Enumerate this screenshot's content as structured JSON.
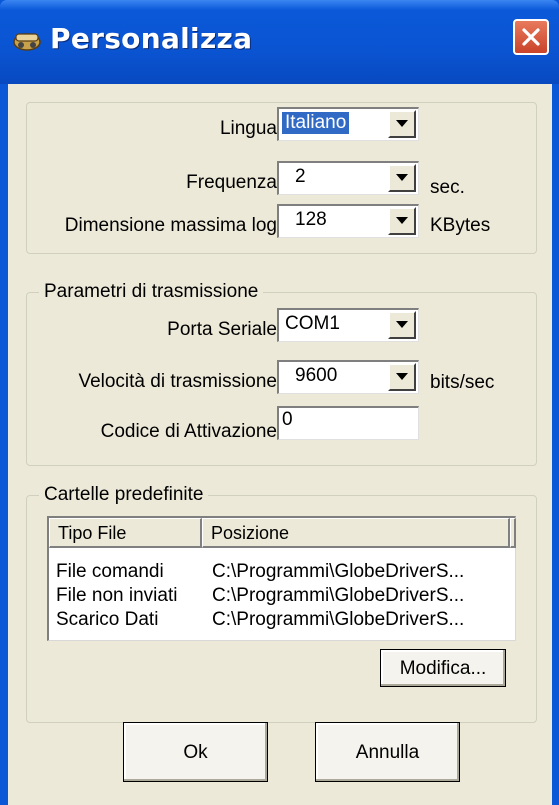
{
  "window": {
    "title": "Personalizza"
  },
  "general": {
    "lingua": {
      "label": "Lingua",
      "value": "Italiano"
    },
    "frequenza": {
      "label": "Frequenza",
      "value": "2",
      "unit": "sec."
    },
    "dimensione": {
      "label": "Dimensione massima log",
      "value": "128",
      "unit": "KBytes"
    }
  },
  "transmission": {
    "title": "Parametri di trasmissione",
    "porta": {
      "label": "Porta Seriale",
      "value": "COM1"
    },
    "velocita": {
      "label": "Velocità di trasmissione",
      "value": "9600",
      "unit": "bits/sec"
    },
    "codice": {
      "label": "Codice di Attivazione",
      "value": "0"
    }
  },
  "folders": {
    "title": "Cartelle predefinite",
    "columns": [
      "Tipo File",
      "Posizione"
    ],
    "rows": [
      {
        "tipo": "File comandi",
        "posizione": "C:\\Programmi\\GlobeDriverS..."
      },
      {
        "tipo": "File non inviati",
        "posizione": "C:\\Programmi\\GlobeDriverS..."
      },
      {
        "tipo": "Scarico Dati",
        "posizione": "C:\\Programmi\\GlobeDriverS..."
      }
    ],
    "modifica_label": "Modifica..."
  },
  "buttons": {
    "ok": "Ok",
    "annulla": "Annulla"
  }
}
